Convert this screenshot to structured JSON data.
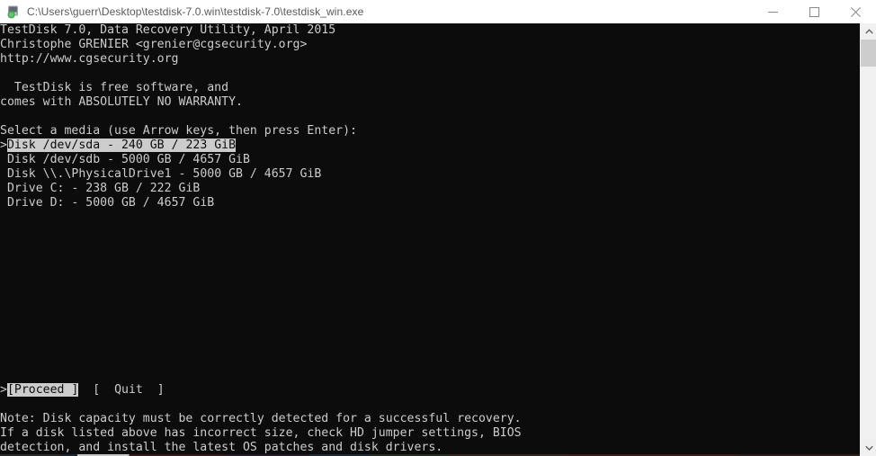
{
  "window": {
    "title": "C:\\Users\\guerr\\Desktop\\testdisk-7.0.win\\testdisk-7.0\\testdisk_win.exe",
    "icon": "testdisk-app-icon",
    "controls": {
      "minimize": "minimize-icon",
      "maximize": "maximize-icon",
      "close": "close-icon"
    }
  },
  "colors": {
    "titlebar_bg": "#ffffff",
    "titlebar_text": "#5a5a5a",
    "terminal_bg": "#0c0c0c",
    "terminal_text": "#cccccc",
    "highlight_bg": "#cccccc",
    "highlight_text": "#0c0c0c",
    "scrollbar_track": "#f0f0f0",
    "scrollbar_thumb": "#cdcdcd"
  },
  "console": {
    "header": {
      "line1": "TestDisk 7.0, Data Recovery Utility, April 2015",
      "line2": "Christophe GRENIER <grenier@cgsecurity.org>",
      "line3": "http://www.cgsecurity.org",
      "blank1": "",
      "line4": "  TestDisk is free software, and",
      "line5": "comes with ABSOLUTELY NO WARRANTY.",
      "blank2": ""
    },
    "prompt": "Select a media (use Arrow keys, then press Enter):",
    "media_list": [
      {
        "marker": ">",
        "label": "Disk /dev/sda - 240 GB / 223 GiB",
        "selected": true
      },
      {
        "marker": " ",
        "label": "Disk /dev/sdb - 5000 GB / 4657 GiB",
        "selected": false
      },
      {
        "marker": " ",
        "label": "Disk \\\\.\\PhysicalDrive1 - 5000 GB / 4657 GiB",
        "selected": false
      },
      {
        "marker": " ",
        "label": "Drive C: - 238 GB / 222 GiB",
        "selected": false
      },
      {
        "marker": " ",
        "label": "Drive D: - 5000 GB / 4657 GiB",
        "selected": false
      }
    ],
    "buttons": {
      "marker": ">",
      "proceed": "[Proceed ]",
      "gap": "  ",
      "quit": "[  Quit  ]"
    },
    "note": {
      "line1": "Note: Disk capacity must be correctly detected for a successful recovery.",
      "line2": "If a disk listed above has incorrect size, check HD jumper settings, BIOS",
      "line3": "detection, and install the latest OS patches and disk drivers."
    }
  },
  "scrollbar": {
    "up_arrow": "chevron-up-icon",
    "down_arrow": "chevron-down-icon",
    "thumb_position_pct": 0,
    "thumb_size_pct": 7
  }
}
